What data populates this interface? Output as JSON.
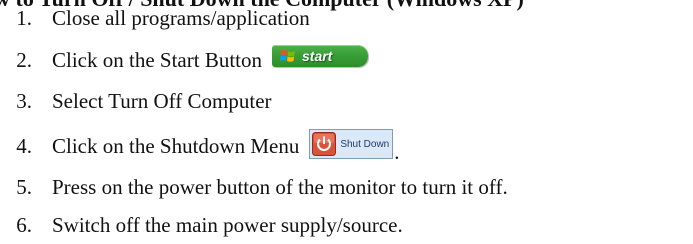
{
  "document": {
    "title": "How to Turn Off / Shut Down the Computer (Windows XP)",
    "steps": [
      {
        "number": "1.",
        "text": "Close all programs/application"
      },
      {
        "number": "2.",
        "text": "Click on the Start Button"
      },
      {
        "number": "3.",
        "text": "Select Turn Off Computer"
      },
      {
        "number": "4.",
        "text": "Click on the Shutdown Menu"
      },
      {
        "number": "5.",
        "text": "Press on the power button of the monitor to turn it off."
      },
      {
        "number": "6.",
        "text": "Switch off the main power supply/source."
      }
    ],
    "start_button": {
      "label": "start",
      "icon": "windows-flag-icon",
      "color": "#3aa038"
    },
    "shutdown_button": {
      "label": "Shut Down",
      "icon": "power-icon",
      "color": "#d9533a"
    },
    "trailing_period": "."
  }
}
